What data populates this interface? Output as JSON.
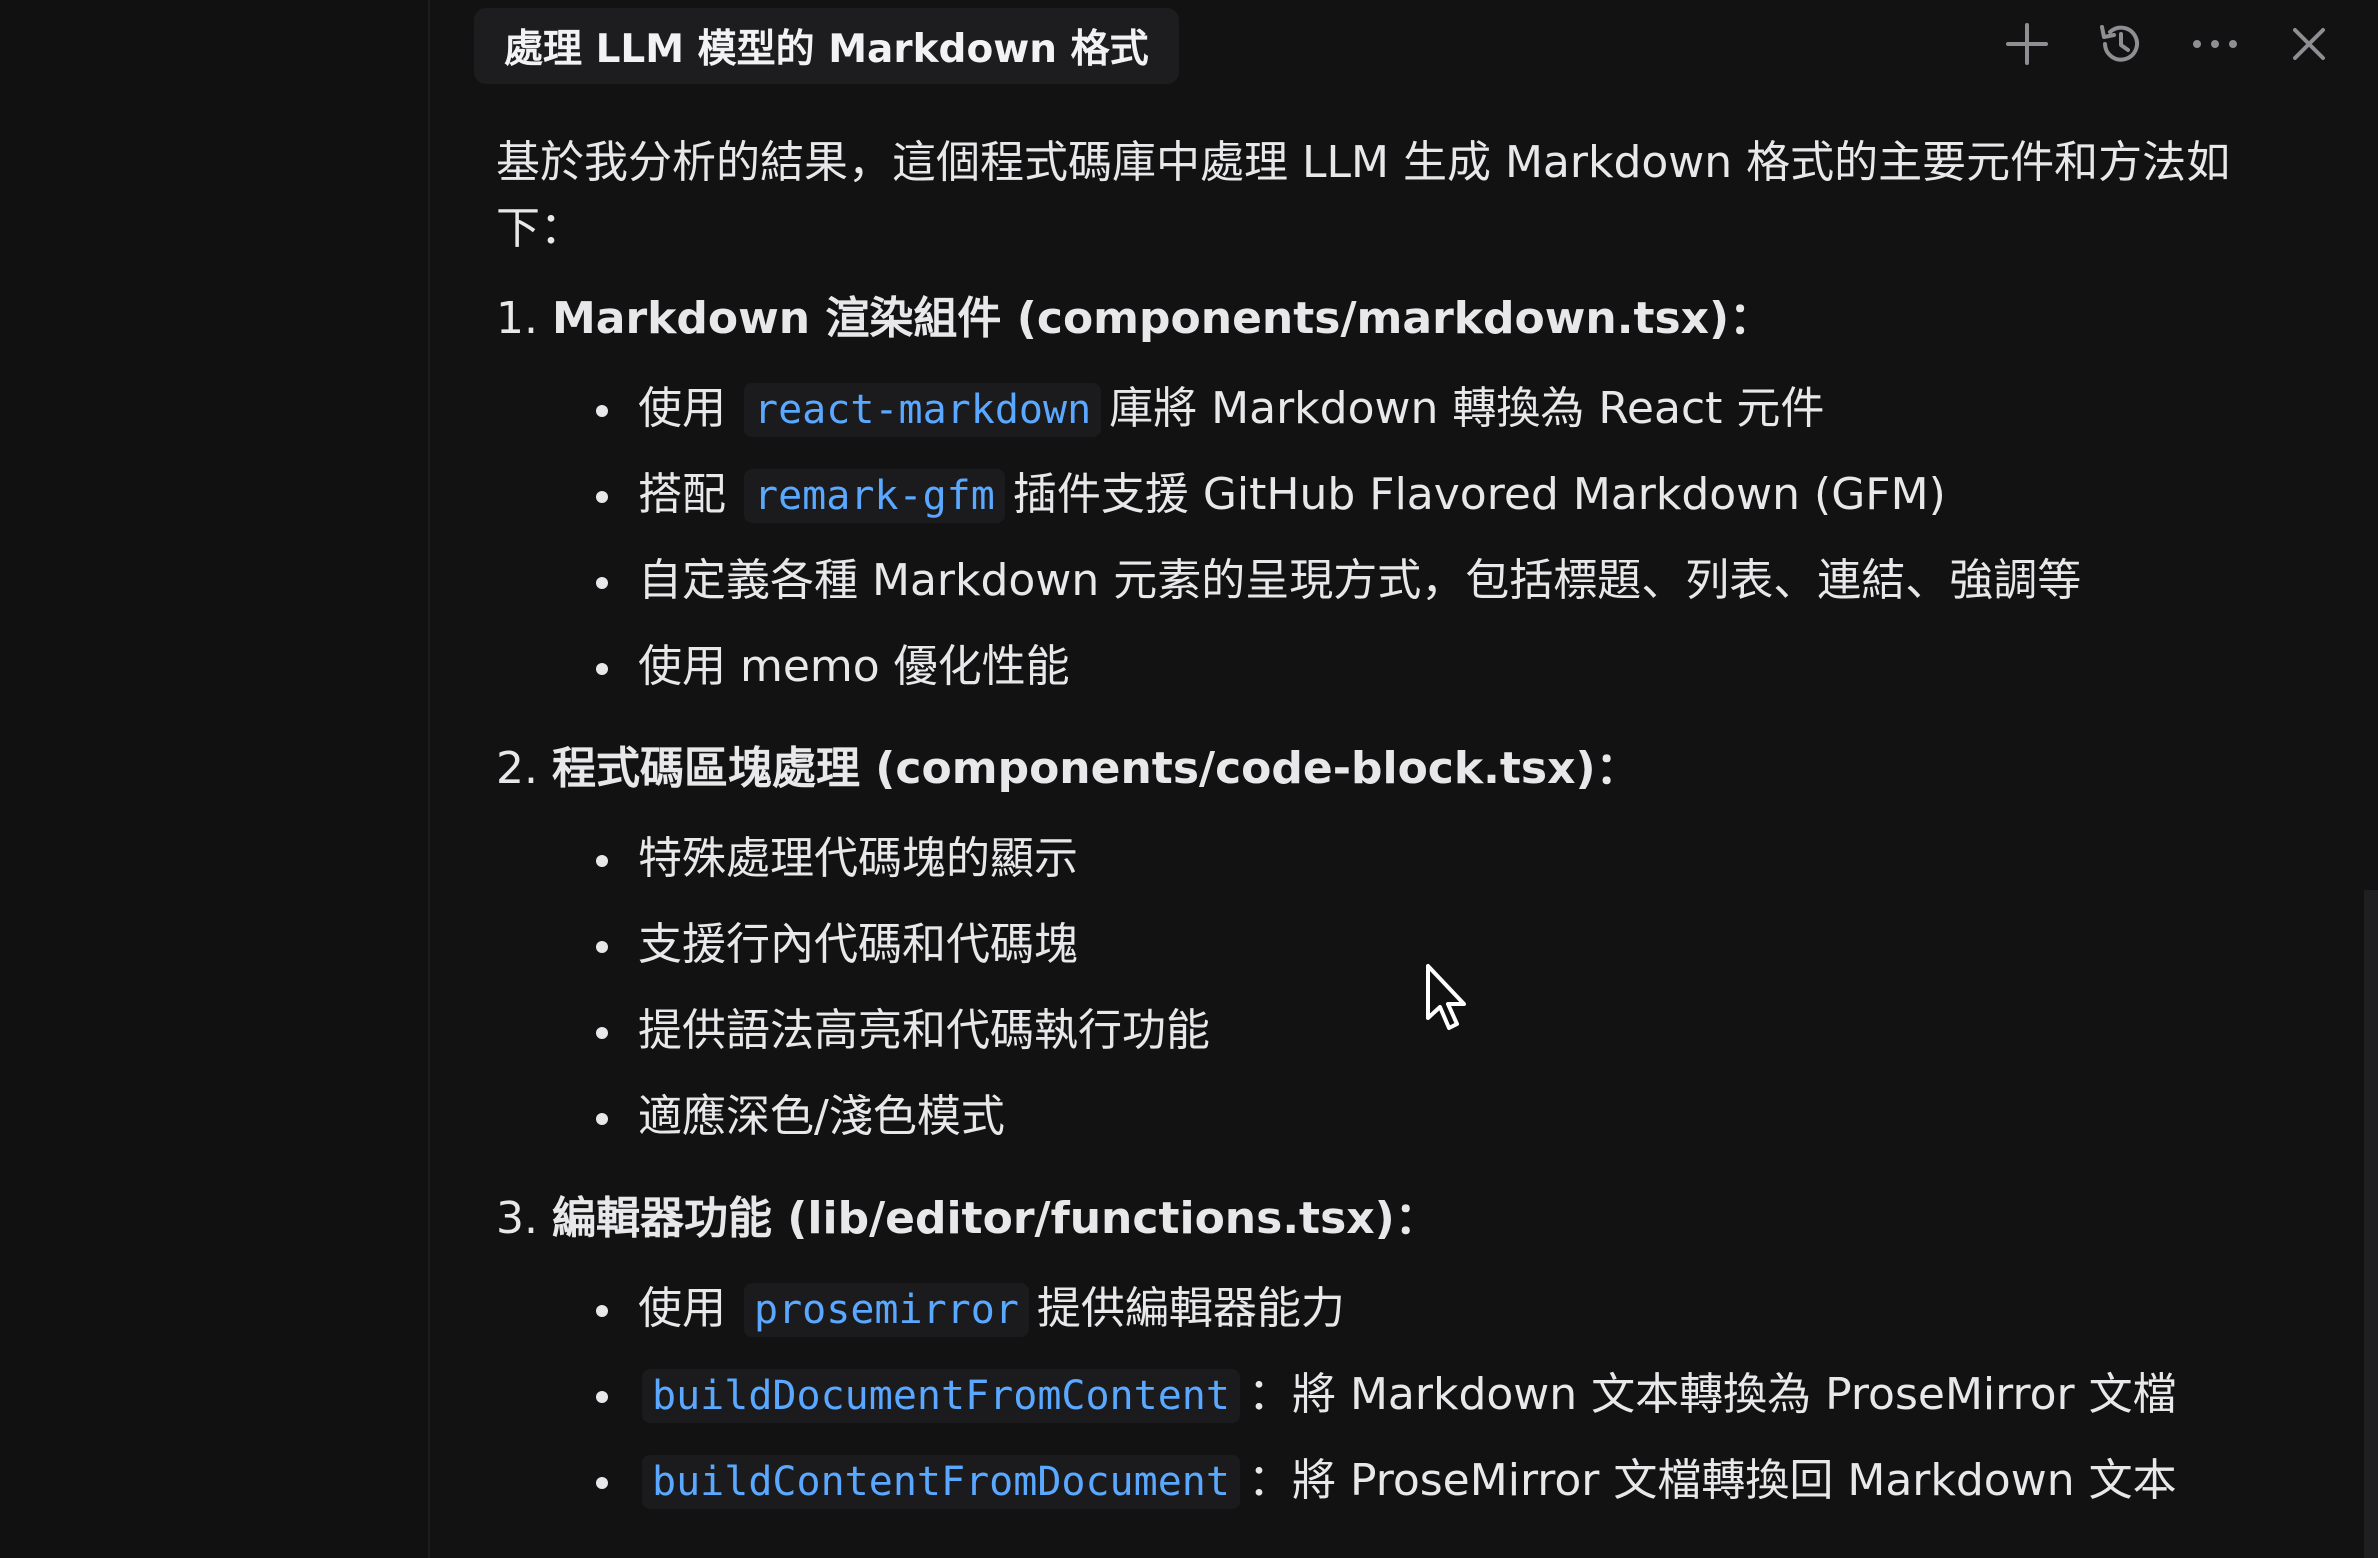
{
  "header": {
    "title": "處理 LLM 模型的 Markdown 格式",
    "icons": [
      "plus-icon",
      "history-icon",
      "more-icon",
      "close-icon"
    ]
  },
  "intro": "基於我分析的結果，這個程式碼庫中處理 LLM 生成 Markdown 格式的主要元件和方法如下：",
  "sections": [
    {
      "num": "1.",
      "title": "Markdown 渲染組件 (components/markdown.tsx)：",
      "items": [
        {
          "pre": "使用",
          "code": "react-markdown",
          "post": "庫將 Markdown 轉換為 React 元件"
        },
        {
          "pre": "搭配",
          "code": "remark-gfm",
          "post": "插件支援 GitHub Flavored Markdown (GFM)"
        },
        {
          "pre": "自定義各種 Markdown 元素的呈現方式，包括標題、列表、連結、強調等",
          "code": "",
          "post": ""
        },
        {
          "pre": "使用 memo 優化性能",
          "code": "",
          "post": ""
        }
      ]
    },
    {
      "num": "2.",
      "title": "程式碼區塊處理 (components/code-block.tsx)：",
      "items": [
        {
          "pre": "特殊處理代碼塊的顯示",
          "code": "",
          "post": ""
        },
        {
          "pre": "支援行內代碼和代碼塊",
          "code": "",
          "post": ""
        },
        {
          "pre": "提供語法高亮和代碼執行功能",
          "code": "",
          "post": ""
        },
        {
          "pre": "適應深色/淺色模式",
          "code": "",
          "post": ""
        }
      ]
    },
    {
      "num": "3.",
      "title": "編輯器功能 (lib/editor/functions.tsx)：",
      "items": [
        {
          "pre": "使用",
          "code": "prosemirror",
          "post": "提供編輯器能力"
        },
        {
          "pre": "",
          "code": "buildDocumentFromContent",
          "post": "：將 Markdown 文本轉換為 ProseMirror 文檔"
        },
        {
          "pre": "",
          "code": "buildContentFromDocument",
          "post": "：將 ProseMirror 文檔轉換回 Markdown 文本"
        }
      ]
    }
  ],
  "colors": {
    "background": "#121212",
    "code_text": "#5aa8ff",
    "code_bg": "#1b1b1d",
    "title_bg": "#1d1d1f"
  }
}
